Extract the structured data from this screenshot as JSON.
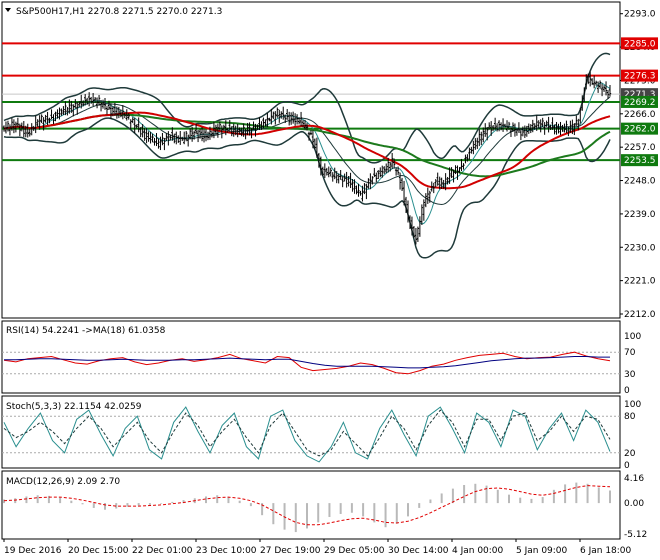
{
  "header": {
    "symbol_line": "S&P500H17,H1  2270.8 2271.5 2270.0 2271.3"
  },
  "colors": {
    "candle": "#000000",
    "bollinger": "#1f3a3a",
    "ma_green": "#1d7a1d",
    "ma_red": "#d10000",
    "ma_teal": "#2a8f8f",
    "support_line": "#0f7a0f",
    "resistance_line": "#e00000",
    "rsi_red": "#e00000",
    "rsi_navy": "#000080",
    "stoch_teal": "#2a8f8f",
    "stoch_dash": "#1f3a3a",
    "macd_hist": "#b9b9b9",
    "macd_signal": "#e00000",
    "tag_red": "#e00000",
    "tag_green": "#0f7a0f",
    "tag_gray": "#444444"
  },
  "chart_data": [
    {
      "type": "candlestick",
      "title": "S&P500H17,H1",
      "ohlc_last": {
        "open": 2270.8,
        "high": 2271.5,
        "low": 2270.0,
        "close": 2271.3
      },
      "ylim": [
        2212.0,
        2294.0
      ],
      "y_ticks": [
        "2293.0",
        "2284.0",
        "2275.0",
        "2266.0",
        "2257.0",
        "2248.0",
        "2239.0",
        "2230.0",
        "2221.0",
        "2212.0"
      ],
      "x_ticks": [
        "19 Dec 2016",
        "20 Dec 15:00",
        "22 Dec 01:00",
        "23 Dec 10:00",
        "27 Dec 19:00",
        "29 Dec 05:00",
        "30 Dec 14:00",
        "4 Jan 00:00",
        "5 Jan 09:00",
        "6 Jan 18:00"
      ],
      "close_path": [
        [
          0,
          2262
        ],
        [
          6,
          2263
        ],
        [
          12,
          2261
        ],
        [
          18,
          2264
        ],
        [
          24,
          2265
        ],
        [
          30,
          2267
        ],
        [
          36,
          2268
        ],
        [
          42,
          2270
        ],
        [
          48,
          2269
        ],
        [
          54,
          2267
        ],
        [
          60,
          2266
        ],
        [
          66,
          2263
        ],
        [
          72,
          2260
        ],
        [
          78,
          2258
        ],
        [
          84,
          2260
        ],
        [
          90,
          2259
        ],
        [
          96,
          2261
        ],
        [
          102,
          2260
        ],
        [
          108,
          2262
        ],
        [
          114,
          2262
        ],
        [
          120,
          2261
        ],
        [
          126,
          2262
        ],
        [
          132,
          2264
        ],
        [
          138,
          2266
        ],
        [
          144,
          2265
        ],
        [
          150,
          2264
        ],
        [
          156,
          2259
        ],
        [
          160,
          2251
        ],
        [
          164,
          2250
        ],
        [
          168,
          2249
        ],
        [
          174,
          2248
        ],
        [
          180,
          2244
        ],
        [
          186,
          2249
        ],
        [
          192,
          2251
        ],
        [
          196,
          2253
        ],
        [
          200,
          2248
        ],
        [
          204,
          2238
        ],
        [
          208,
          2232
        ],
        [
          212,
          2242
        ],
        [
          218,
          2248
        ],
        [
          222,
          2247
        ],
        [
          226,
          2250
        ],
        [
          230,
          2251
        ],
        [
          234,
          2255
        ],
        [
          238,
          2258
        ],
        [
          244,
          2262
        ],
        [
          250,
          2263
        ],
        [
          256,
          2262
        ],
        [
          262,
          2261
        ],
        [
          268,
          2263
        ],
        [
          274,
          2263
        ],
        [
          280,
          2262
        ],
        [
          286,
          2262
        ],
        [
          290,
          2264
        ],
        [
          294,
          2276
        ],
        [
          298,
          2274
        ],
        [
          302,
          2273
        ],
        [
          306,
          2271.3
        ]
      ],
      "horizontal_levels": [
        {
          "value": 2285.0,
          "label": "2285.0",
          "color": "red"
        },
        {
          "value": 2276.3,
          "label": "2276.3",
          "color": "red"
        },
        {
          "value": 2271.3,
          "label": "2271.3",
          "color": "gray"
        },
        {
          "value": 2269.2,
          "label": "2269.2",
          "color": "green"
        },
        {
          "value": 2262.0,
          "label": "2262.0",
          "color": "green"
        },
        {
          "value": 2253.5,
          "label": "2253.5",
          "color": "green"
        }
      ]
    },
    {
      "type": "line",
      "title": "RSI(14) 54.2241 ->MA(18) 61.0358",
      "ylim": [
        0,
        100
      ],
      "y_ticks": [
        "100",
        "70",
        "30",
        "0"
      ],
      "series": [
        {
          "name": "RSI(14)",
          "value": 54.2241,
          "values": [
            55,
            52,
            58,
            60,
            62,
            56,
            50,
            48,
            54,
            58,
            60,
            52,
            47,
            50,
            55,
            58,
            53,
            56,
            60,
            66,
            58,
            54,
            50,
            62,
            60,
            42,
            36,
            38,
            40,
            44,
            50,
            47,
            40,
            32,
            30,
            36,
            44,
            48,
            55,
            60,
            64,
            66,
            68,
            62,
            58,
            60,
            61,
            66,
            70,
            63,
            58,
            54
          ]
        },
        {
          "name": "MA(18)",
          "value": 61.0358,
          "values": [
            56,
            56,
            57,
            58,
            58,
            57,
            56,
            55,
            55,
            56,
            57,
            56,
            55,
            55,
            55,
            56,
            56,
            57,
            58,
            59,
            58,
            57,
            56,
            57,
            57,
            53,
            49,
            46,
            44,
            44,
            44,
            44,
            43,
            42,
            41,
            41,
            42,
            43,
            45,
            48,
            51,
            54,
            56,
            58,
            59,
            59,
            60,
            61,
            62,
            62,
            61,
            61
          ]
        }
      ]
    },
    {
      "type": "line",
      "title": "Stoch(5,3,3) 22.1154 42.0259",
      "ylim": [
        0,
        100
      ],
      "y_ticks": [
        "100",
        "80",
        "20",
        "0"
      ],
      "series": [
        {
          "name": "%K",
          "value": 22.1154,
          "values": [
            70,
            30,
            60,
            85,
            40,
            20,
            75,
            90,
            50,
            15,
            60,
            80,
            25,
            10,
            70,
            95,
            55,
            20,
            65,
            85,
            30,
            10,
            80,
            90,
            40,
            15,
            5,
            30,
            70,
            20,
            10,
            60,
            90,
            50,
            15,
            80,
            95,
            60,
            20,
            85,
            70,
            30,
            90,
            80,
            25,
            60,
            85,
            40,
            90,
            70,
            22
          ]
        },
        {
          "name": "%D",
          "value": 42.0259,
          "values": [
            60,
            45,
            55,
            70,
            55,
            35,
            60,
            80,
            60,
            30,
            50,
            70,
            40,
            20,
            55,
            85,
            65,
            30,
            55,
            75,
            45,
            20,
            65,
            85,
            55,
            25,
            15,
            25,
            55,
            35,
            15,
            45,
            80,
            60,
            25,
            65,
            90,
            70,
            30,
            75,
            75,
            40,
            80,
            85,
            40,
            55,
            80,
            55,
            80,
            75,
            42
          ]
        }
      ]
    },
    {
      "type": "bar",
      "title": "MACD(12,26,9) 2.09 2.70",
      "ylim": [
        -5.12,
        4.16
      ],
      "y_ticks": [
        "4.16",
        "0.00",
        "-5.12"
      ],
      "series": [
        {
          "name": "MACD",
          "value": 2.09,
          "values": [
            0.6,
            0.8,
            1.1,
            1.3,
            1.2,
            0.9,
            0.4,
            -0.2,
            -0.8,
            -1.1,
            -0.9,
            -0.6,
            -0.4,
            -0.3,
            -0.1,
            0.2,
            0.5,
            0.8,
            1.1,
            1.3,
            1.0,
            0.4,
            -0.5,
            -2.0,
            -3.5,
            -4.4,
            -4.8,
            -4.2,
            -3.2,
            -2.3,
            -1.8,
            -1.6,
            -2.2,
            -3.2,
            -4.0,
            -3.4,
            -2.2,
            -0.8,
            0.6,
            1.6,
            2.4,
            3.0,
            3.2,
            2.9,
            2.2,
            1.4,
            0.9,
            0.7,
            1.0,
            2.2,
            3.1,
            3.4,
            3.2,
            2.6,
            2.09
          ]
        },
        {
          "name": "Signal",
          "value": 2.7,
          "values": [
            0.4,
            0.5,
            0.7,
            0.9,
            1.0,
            1.0,
            0.8,
            0.5,
            0.1,
            -0.3,
            -0.5,
            -0.5,
            -0.5,
            -0.4,
            -0.3,
            -0.1,
            0.1,
            0.4,
            0.7,
            0.9,
            1.0,
            0.8,
            0.4,
            -0.3,
            -1.3,
            -2.3,
            -3.2,
            -3.6,
            -3.6,
            -3.3,
            -2.9,
            -2.6,
            -2.5,
            -2.8,
            -3.2,
            -3.3,
            -3.0,
            -2.4,
            -1.6,
            -0.7,
            0.2,
            1.1,
            1.9,
            2.4,
            2.5,
            2.3,
            1.9,
            1.5,
            1.3,
            1.6,
            2.1,
            2.6,
            2.9,
            2.8,
            2.7
          ]
        }
      ]
    }
  ]
}
